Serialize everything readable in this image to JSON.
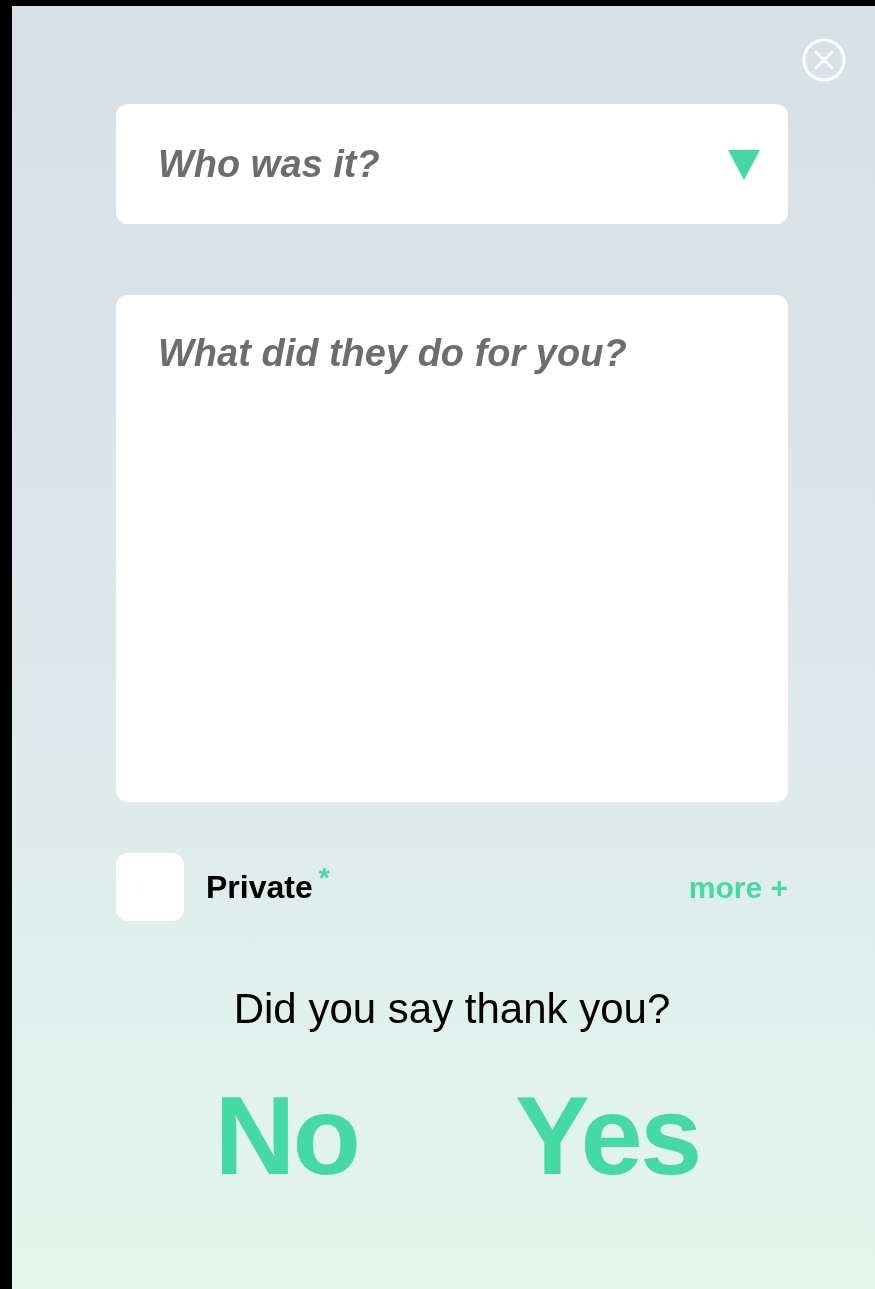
{
  "who_select": {
    "placeholder": "Who was it?"
  },
  "description_field": {
    "placeholder": "What did they do for you?"
  },
  "private_option": {
    "label": "Private",
    "required_mark": "*",
    "checked": false
  },
  "more_link": "more +",
  "question": "Did you say thank you?",
  "answers": [
    {
      "label": "No"
    },
    {
      "label": "Yes"
    }
  ]
}
